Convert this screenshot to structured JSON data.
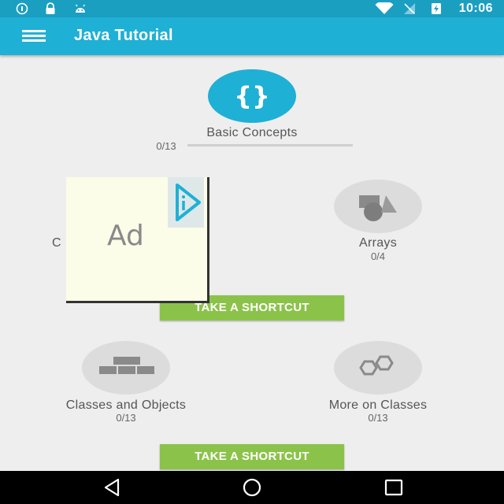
{
  "status_bar": {
    "time": "10:06",
    "left_icons": [
      "alarm-icon",
      "lock-icon",
      "android-icon"
    ],
    "right_icons": [
      "wifi-icon",
      "no-signal-icon",
      "battery-charging-icon"
    ]
  },
  "app_bar": {
    "title": "Java Tutorial",
    "menu_icon": "hamburger-menu-icon"
  },
  "lessons": [
    {
      "name": "Basic Concepts",
      "progress": "0/13",
      "icon": "braces-icon",
      "active": true
    },
    {
      "name": "C",
      "progress": "",
      "icon": "",
      "active": false
    },
    {
      "name": "Arrays",
      "progress": "0/4",
      "icon": "shapes-icon",
      "active": false
    },
    {
      "name": "Classes and Objects",
      "progress": "0/13",
      "icon": "bricks-icon",
      "active": false
    },
    {
      "name": "More on Classes",
      "progress": "0/13",
      "icon": "hexagons-icon",
      "active": false
    }
  ],
  "buttons": {
    "shortcut_1": "TAKE A SHORTCUT",
    "shortcut_2": "TAKE A SHORTCUT"
  },
  "ad": {
    "text": "Ad",
    "badge_icon": "ad-choices-icon"
  },
  "nav_bar": {
    "icons": [
      "back-icon",
      "home-icon",
      "recents-icon"
    ]
  },
  "colors": {
    "primary": "#1fb0d6",
    "status_bar": "#1a9fc1",
    "accent_button": "#8bc34a",
    "background": "#eeeeee",
    "icon_gray": "#8a8a8a"
  }
}
